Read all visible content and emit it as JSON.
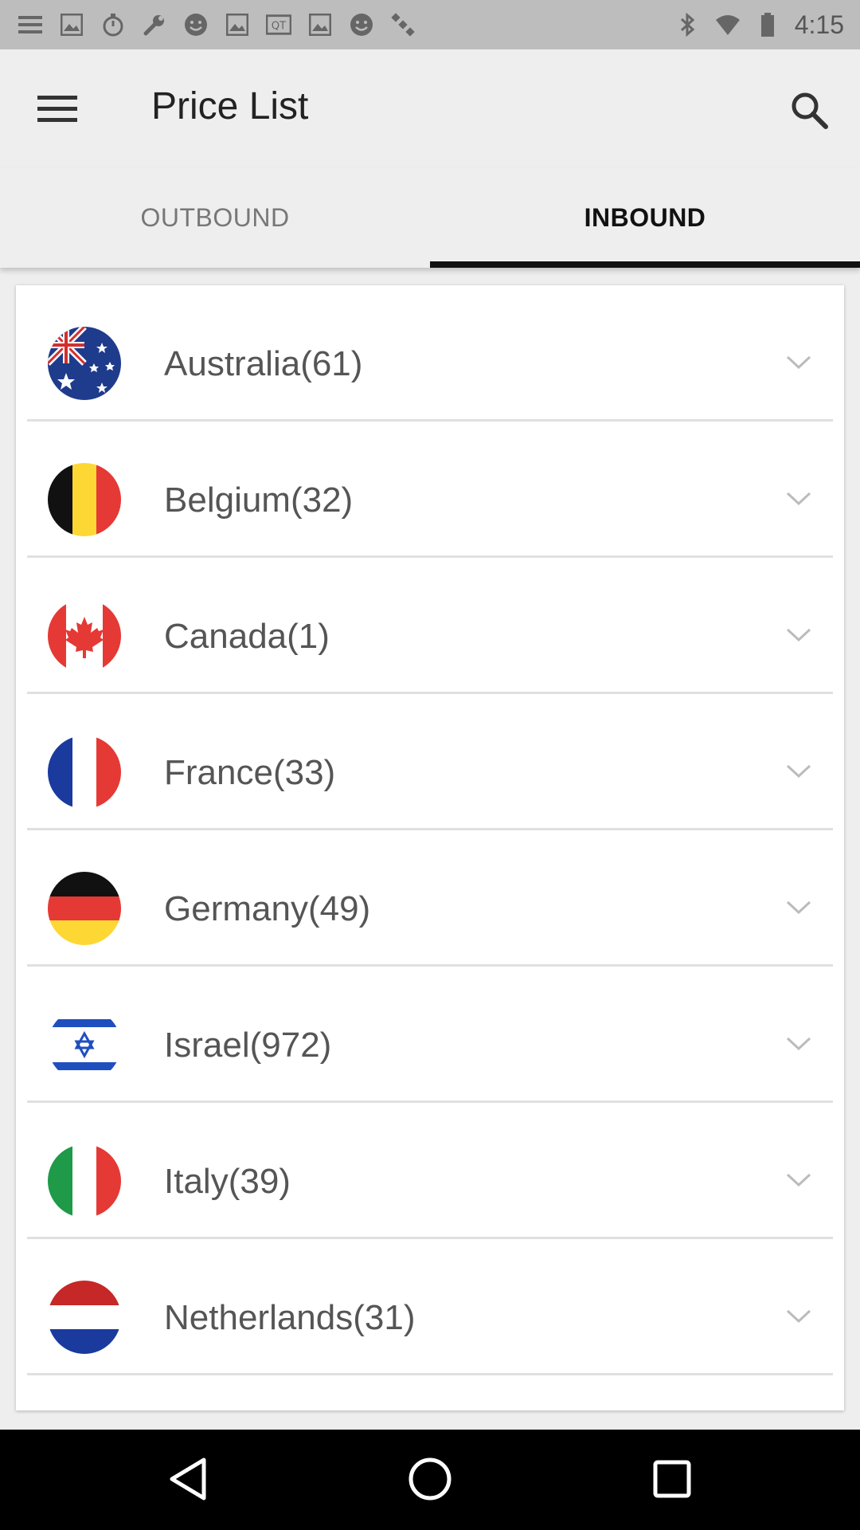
{
  "status_bar": {
    "time": "4:15",
    "left_icons": [
      "menu-icon",
      "image-icon",
      "timer-icon",
      "wrench-icon",
      "smiley-icon",
      "image-icon",
      "qq-icon",
      "image-icon",
      "smiley-icon",
      "satellite-icon"
    ],
    "right_icons": [
      "bluetooth-icon",
      "wifi-icon",
      "battery-icon"
    ]
  },
  "app_bar": {
    "title": "Price List",
    "menu_icon": "menu-icon",
    "search_icon": "search-icon"
  },
  "tabs": [
    {
      "label": "OUTBOUND",
      "active": false
    },
    {
      "label": "INBOUND",
      "active": true
    }
  ],
  "countries": [
    {
      "label": "Australia(61)",
      "flag": "australia"
    },
    {
      "label": "Belgium(32)",
      "flag": "belgium"
    },
    {
      "label": "Canada(1)",
      "flag": "canada"
    },
    {
      "label": "France(33)",
      "flag": "france"
    },
    {
      "label": "Germany(49)",
      "flag": "germany"
    },
    {
      "label": "Israel(972)",
      "flag": "israel"
    },
    {
      "label": "Italy(39)",
      "flag": "italy"
    },
    {
      "label": "Netherlands(31)",
      "flag": "netherlands"
    }
  ],
  "nav_bar": {
    "icons": [
      "back-icon",
      "home-icon",
      "recents-icon"
    ]
  },
  "colors": {
    "background": "#eeeeee",
    "tab_indicator": "#111111",
    "list_text": "#555555"
  }
}
